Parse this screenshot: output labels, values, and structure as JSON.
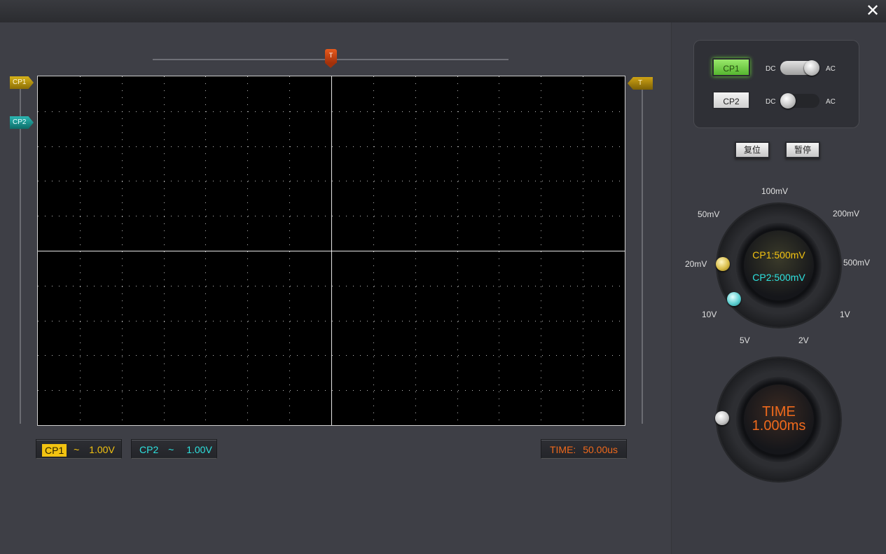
{
  "window": {
    "close_label": "✕"
  },
  "trigger": {
    "marker_label": "T"
  },
  "channel_tags": {
    "cp1": "CP1",
    "cp2": "CP2",
    "trigger": "T"
  },
  "readouts": {
    "cp1": {
      "name": "CP1",
      "coupling": "~",
      "value": "1.00V"
    },
    "cp2": {
      "name": "CP2",
      "coupling": "~",
      "value": "1.00V"
    },
    "time": {
      "label": "TIME:",
      "value": "50.00us"
    }
  },
  "channels": {
    "cp1": {
      "label": "CP1",
      "dc": "DC",
      "ac": "AC",
      "mode": "AC",
      "active": true
    },
    "cp2": {
      "label": "CP2",
      "dc": "DC",
      "ac": "AC",
      "mode": "DC",
      "active": false
    }
  },
  "buttons": {
    "reset": "复位",
    "pause": "暂停"
  },
  "volt_dial": {
    "scale": [
      "100mV",
      "200mV",
      "500mV",
      "1V",
      "2V",
      "5V",
      "10V",
      "20mV",
      "50mV"
    ],
    "cp1_text": "CP1:500mV",
    "cp2_text": "CP2:500mV"
  },
  "time_dial": {
    "line1": "TIME",
    "line2": "1.000ms"
  },
  "colors": {
    "cp1": "#f3c311",
    "cp2": "#2ee2df",
    "time": "#f06a1c",
    "active_button": "#7fd955"
  }
}
